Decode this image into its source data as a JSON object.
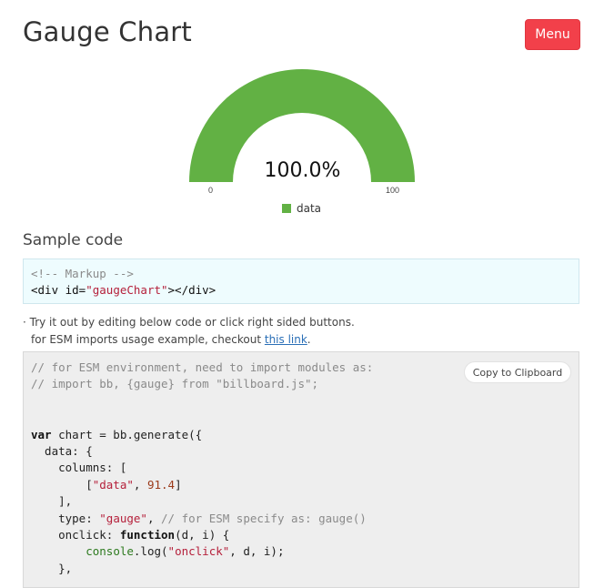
{
  "header": {
    "title": "Gauge Chart",
    "menu_label": "Menu"
  },
  "chart_data": {
    "type": "gauge",
    "value_percent": 100.0,
    "value_label": "100.0%",
    "min_label": "0",
    "max_label": "100",
    "legend": [
      "data"
    ],
    "color": "#62b144"
  },
  "sample": {
    "title": "Sample code",
    "markup_comment": "<!-- Markup -->",
    "markup_div_open": "<div id=",
    "markup_div_id": "\"gaugeChart\"",
    "markup_div_close": "></div>",
    "hint1": "· Try it out by editing below code or click right sided buttons.",
    "hint2_prefix": "for ESM imports usage example, checkout ",
    "hint2_link": "this link",
    "hint2_suffix": ".",
    "copy_label": "Copy to Clipboard"
  },
  "code": {
    "l1": "// for ESM environment, need to import modules as:",
    "l2": "// import bb, {gauge} from \"billboard.js\";",
    "l3_kw": "var",
    "l3_rest": " chart = bb.generate({",
    "l4": "  data: {",
    "l5": "    columns: [",
    "l6_a": "        [",
    "l6_str": "\"data\"",
    "l6_b": ", ",
    "l6_num": "91.4",
    "l6_c": "]",
    "l7": "    ],",
    "l8_a": "    type: ",
    "l8_str": "\"gauge\"",
    "l8_b": ", ",
    "l8_cm": "// for ESM specify as: gauge()",
    "l9_a": "    onclick: ",
    "l9_kw": "function",
    "l9_b": "(d, i) {",
    "l10_a": "        ",
    "l10_fn": "console",
    "l10_b": ".log(",
    "l10_str": "\"onclick\"",
    "l10_c": ", d, i);",
    "l11": "    },"
  }
}
